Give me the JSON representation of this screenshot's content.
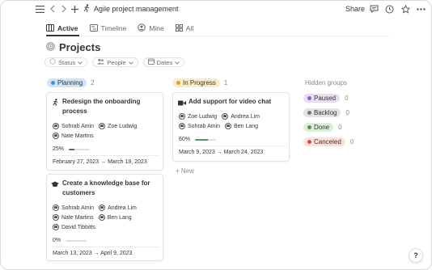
{
  "breadcrumb": {
    "title": "Agile project management"
  },
  "topbar": {
    "share_label": "Share"
  },
  "tabs": [
    {
      "label": "Active"
    },
    {
      "label": "Timeline"
    },
    {
      "label": "Mine"
    },
    {
      "label": "All"
    }
  ],
  "page": {
    "title": "Projects"
  },
  "filters": [
    {
      "label": "Status"
    },
    {
      "label": "People"
    },
    {
      "label": "Dates"
    }
  ],
  "columns": [
    {
      "name": "Planning",
      "count": "2",
      "color": "#cfe4f6",
      "dot": "#4e8ec9"
    },
    {
      "name": "In Progress",
      "count": "1",
      "color": "#fbecc9",
      "dot": "#d9a23a"
    }
  ],
  "cards": [
    {
      "title": "Redesign the onboarding process",
      "title_lines": [
        "Redesign the onboarding",
        "process"
      ],
      "people_rows": [
        [
          "Sohrab Amin",
          "Zoe Ludwig"
        ],
        [
          "Nate Martins"
        ]
      ],
      "progress": "25%",
      "progress_value": 0.25,
      "dates": "February 27, 2023 → March 19, 2023"
    },
    {
      "title": "Create a knowledge base for customers",
      "title_lines": [
        "Create a knowledge base for",
        "customers"
      ],
      "people_rows": [
        [
          "Sohrab Amin",
          "Andrea Lim"
        ],
        [
          "Nate Martins",
          "Ben Lang"
        ],
        [
          "David Tibbitts"
        ]
      ],
      "progress": "0%",
      "progress_value": 0,
      "dates": "March 13, 2023 → April 9, 2023"
    },
    {
      "title": "Add support for video chat",
      "title_lines": [
        "Add support for video chat"
      ],
      "people_rows": [
        [
          "Zoe Ludwig",
          "Andrea Lim"
        ],
        [
          "Sohrab Amin",
          "Ben Lang"
        ]
      ],
      "progress": "60%",
      "progress_value": 0.6,
      "dates": "March 9, 2023 → March 24, 2023"
    }
  ],
  "new_label": "+ New",
  "hidden_groups": {
    "title": "Hidden groups",
    "items": [
      {
        "name": "Paused",
        "count": "0",
        "color": "#e8def3",
        "dot": "#9065b0"
      },
      {
        "name": "Backlog",
        "count": "0",
        "color": "#e3e2e0",
        "dot": "#787774"
      },
      {
        "name": "Done",
        "count": "0",
        "color": "#dbeddb",
        "dot": "#4f9768"
      },
      {
        "name": "Canceled",
        "count": "0",
        "color": "#fbe0dc",
        "dot": "#d44c47"
      }
    ]
  },
  "help_label": "?"
}
